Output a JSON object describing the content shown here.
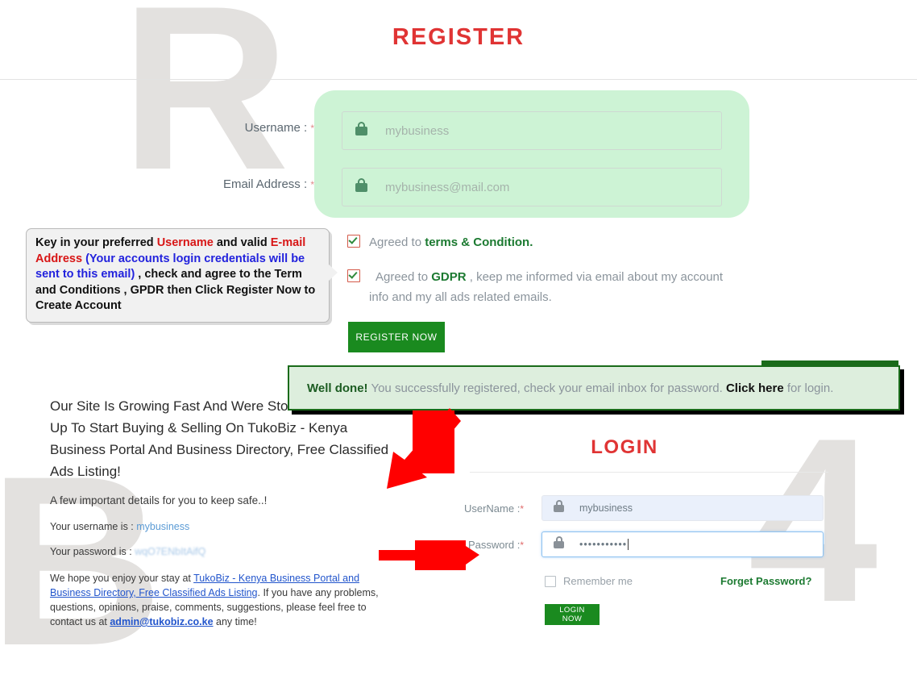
{
  "watermarks": {
    "register_letter": "R",
    "email_letter": "B",
    "login_number": "4"
  },
  "register": {
    "title": "REGISTER",
    "fields": [
      {
        "label": "Username :",
        "required_mark": "*",
        "placeholder": "mybusiness",
        "icon": "lock-icon"
      },
      {
        "label": "Email Address :",
        "required_mark": "*",
        "placeholder": "mybusiness@mail.com",
        "icon": "lock-icon"
      }
    ],
    "checkboxes": [
      {
        "checked": true,
        "prefix": "Agreed to ",
        "strong": "terms & Condition.",
        "suffix": ""
      },
      {
        "checked": true,
        "prefix": "Agreed to ",
        "strong": "GDPR",
        "suffix": " , keep me informed via email about my account info and my all ads related emails."
      }
    ],
    "submit_label": "REGISTER NOW"
  },
  "annotation": {
    "line1_a": "Key in your preferred ",
    "line1_red1": "Username",
    "line1_b": " and valid ",
    "line1_red2": "E-mail Address",
    "line1_c": " ",
    "blue": "(Your accounts login credentials will be sent to this email)",
    "tail": " , check and agree to the Term and Conditions , GPDR then Click Register Now to Create Account"
  },
  "success_banner": {
    "strong": "Well done!",
    "message": " You successfully registered, check your email inbox for password. ",
    "link": "Click here",
    "tail": " for login."
  },
  "email": {
    "headline": "Our Site Is Growing Fast And Were Stoked You Joined Up To Start Buying & Selling On TukoBiz - Kenya Business Portal And Business Directory, Free Classified Ads Listing!",
    "subline": "A few important details for you to keep safe..!",
    "username_label": "Your username is : ",
    "username_value": "mybusiness",
    "password_label": "Your password is : ",
    "password_value": "wqO7ENbItAifQ",
    "para_a": "We hope you enjoy your stay at ",
    "para_link": "TukoBiz - Kenya Business Portal and Business Directory, Free Classified Ads Listing",
    "para_b": ". If you have any problems, questions, opinions, praise, comments, suggestions, please feel free to contact us at ",
    "contact_email": "admin@tukobiz.co.ke",
    "para_c": " any time!"
  },
  "login": {
    "title": "LOGIN",
    "username_label": "UserName :",
    "username_required": "*",
    "username_value": "mybusiness",
    "password_label": "Password :",
    "password_required": "*",
    "password_value": "•••••••••••",
    "remember_label": "Remember me",
    "forget_label": "Forget Password?",
    "submit_label": "LOGIN NOW"
  },
  "colors": {
    "brand_red": "#e03434",
    "brand_green": "#1a8a1f",
    "highlight_green": "#cdf3d5",
    "banner_bg": "#ddeedd",
    "banner_border": "#1a6b1a",
    "arrow_red": "#ff0000",
    "watermark_gray": "#e3e1df"
  }
}
